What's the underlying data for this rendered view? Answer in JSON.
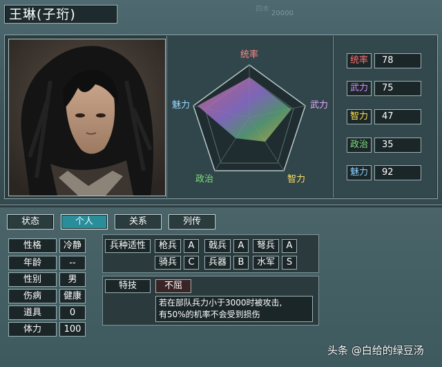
{
  "character": {
    "name": "王琳(子珩)"
  },
  "background_text": {
    "label": "四本",
    "number": "20000"
  },
  "radar": {
    "labels": {
      "leadership": "统率",
      "war": "武力",
      "intelligence": "智力",
      "politics": "政治",
      "charm": "魅力"
    },
    "colors": {
      "leadership": "#ff8a8a",
      "war": "#e6a8ff",
      "intelligence": "#ffe066",
      "politics": "#7fe07f",
      "charm": "#9ad8ff"
    }
  },
  "stats": [
    {
      "label": "统率",
      "value": "78",
      "color": "#ff6f6f"
    },
    {
      "label": "武力",
      "value": "75",
      "color": "#d58cff"
    },
    {
      "label": "智力",
      "value": "47",
      "color": "#ffe14f"
    },
    {
      "label": "政治",
      "value": "35",
      "color": "#7ee07e"
    },
    {
      "label": "魅力",
      "value": "92",
      "color": "#8ad0ff"
    }
  ],
  "tabs": [
    "状态",
    "个人",
    "关系",
    "列传"
  ],
  "active_tab": "个人",
  "personal": [
    {
      "label": "性格",
      "value": "冷静"
    },
    {
      "label": "年龄",
      "value": "--"
    },
    {
      "label": "性别",
      "value": "男"
    },
    {
      "label": "伤病",
      "value": "健康"
    },
    {
      "label": "道具",
      "value": "0"
    },
    {
      "label": "体力",
      "value": "100"
    }
  ],
  "aptitude": {
    "title": "兵种适性",
    "items": [
      {
        "unit": "枪兵",
        "grade": "A"
      },
      {
        "unit": "戟兵",
        "grade": "A"
      },
      {
        "unit": "弩兵",
        "grade": "A"
      },
      {
        "unit": "骑兵",
        "grade": "C"
      },
      {
        "unit": "兵器",
        "grade": "B"
      },
      {
        "unit": "水军",
        "grade": "S"
      }
    ]
  },
  "skill": {
    "label": "特技",
    "name": "不屈",
    "description_line1": "若在部队兵力小于3000时被攻击,",
    "description_line2": "有50%的机率不会受到损伤"
  },
  "watermark": "头条 @白给的绿豆汤"
}
